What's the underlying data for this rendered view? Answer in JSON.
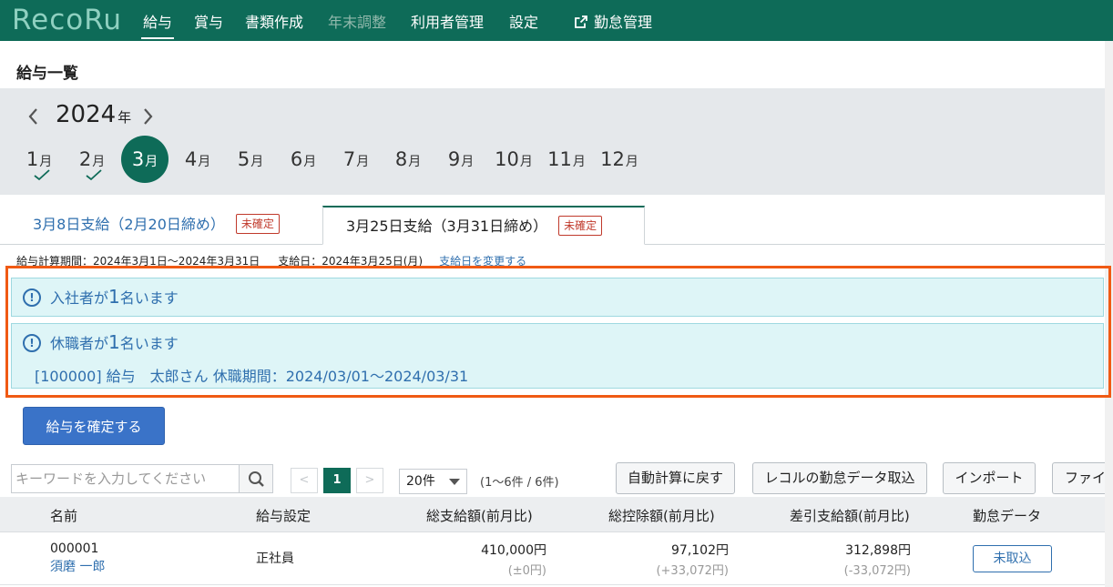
{
  "app": {
    "logo": "RecoRu"
  },
  "nav": {
    "items": [
      {
        "label": "給与"
      },
      {
        "label": "賞与"
      },
      {
        "label": "書類作成"
      },
      {
        "label": "年末調整"
      },
      {
        "label": "利用者管理"
      },
      {
        "label": "設定"
      },
      {
        "label": "勤怠管理"
      }
    ]
  },
  "page": {
    "title": "給与一覧"
  },
  "year_selector": {
    "year": "2024",
    "unit": "年"
  },
  "months": [
    {
      "num": "1",
      "unit": "月",
      "status": "done"
    },
    {
      "num": "2",
      "unit": "月",
      "status": "done"
    },
    {
      "num": "3",
      "unit": "月",
      "status": "selected"
    },
    {
      "num": "4",
      "unit": "月"
    },
    {
      "num": "5",
      "unit": "月"
    },
    {
      "num": "6",
      "unit": "月"
    },
    {
      "num": "7",
      "unit": "月"
    },
    {
      "num": "8",
      "unit": "月"
    },
    {
      "num": "9",
      "unit": "月"
    },
    {
      "num": "10",
      "unit": "月"
    },
    {
      "num": "11",
      "unit": "月"
    },
    {
      "num": "12",
      "unit": "月"
    }
  ],
  "tabs": [
    {
      "label": "3月8日支給（2月20日締め）",
      "badge": "未確定"
    },
    {
      "label": "3月25日支給（3月31日締め）",
      "badge": "未確定"
    }
  ],
  "period": {
    "calc_period": "給与計算期間：2024年3月1日～2024年3月31日",
    "pay_date": "支給日：2024年3月25日(月)",
    "change_link": "支給日を変更する"
  },
  "alerts": [
    {
      "prefix": "入社者が",
      "count": "1",
      "suffix": "名います"
    },
    {
      "prefix": "休職者が",
      "count": "1",
      "suffix": "名います",
      "detail": "[100000] 給与　太郎さん  休職期間：2024/03/01～2024/03/31"
    }
  ],
  "actions": {
    "confirm_label": "給与を確定する"
  },
  "toolbar": {
    "search_placeholder": "キーワードを入力してください",
    "prev": "<",
    "current_page": "1",
    "next": ">",
    "per_page": "20件",
    "range": "(1～6件 / 6件)",
    "buttons": [
      "自動計算に戻す",
      "レコルの勤怠データ取込",
      "インポート",
      "ファイ"
    ]
  },
  "table": {
    "headers": [
      "名前",
      "給与設定",
      "総支給額(前月比)",
      "総控除額(前月比)",
      "差引支給額(前月比)",
      "勤怠データ"
    ],
    "rows": [
      {
        "id": "000001",
        "name": "須磨 一郎",
        "setting": "正社員",
        "gross": "410,000円",
        "gross_diff": "(±0円)",
        "deduction": "97,102円",
        "deduction_diff": "(+33,072円)",
        "net": "312,898円",
        "net_diff": "(-33,072円)",
        "attendance": "未取込"
      }
    ]
  },
  "colors": {
    "brand": "#0e6b58",
    "primary_button": "#3a73c8",
    "alert_bg": "#def5f7",
    "highlight_border": "#f05a14",
    "badge": "#c0392b"
  }
}
